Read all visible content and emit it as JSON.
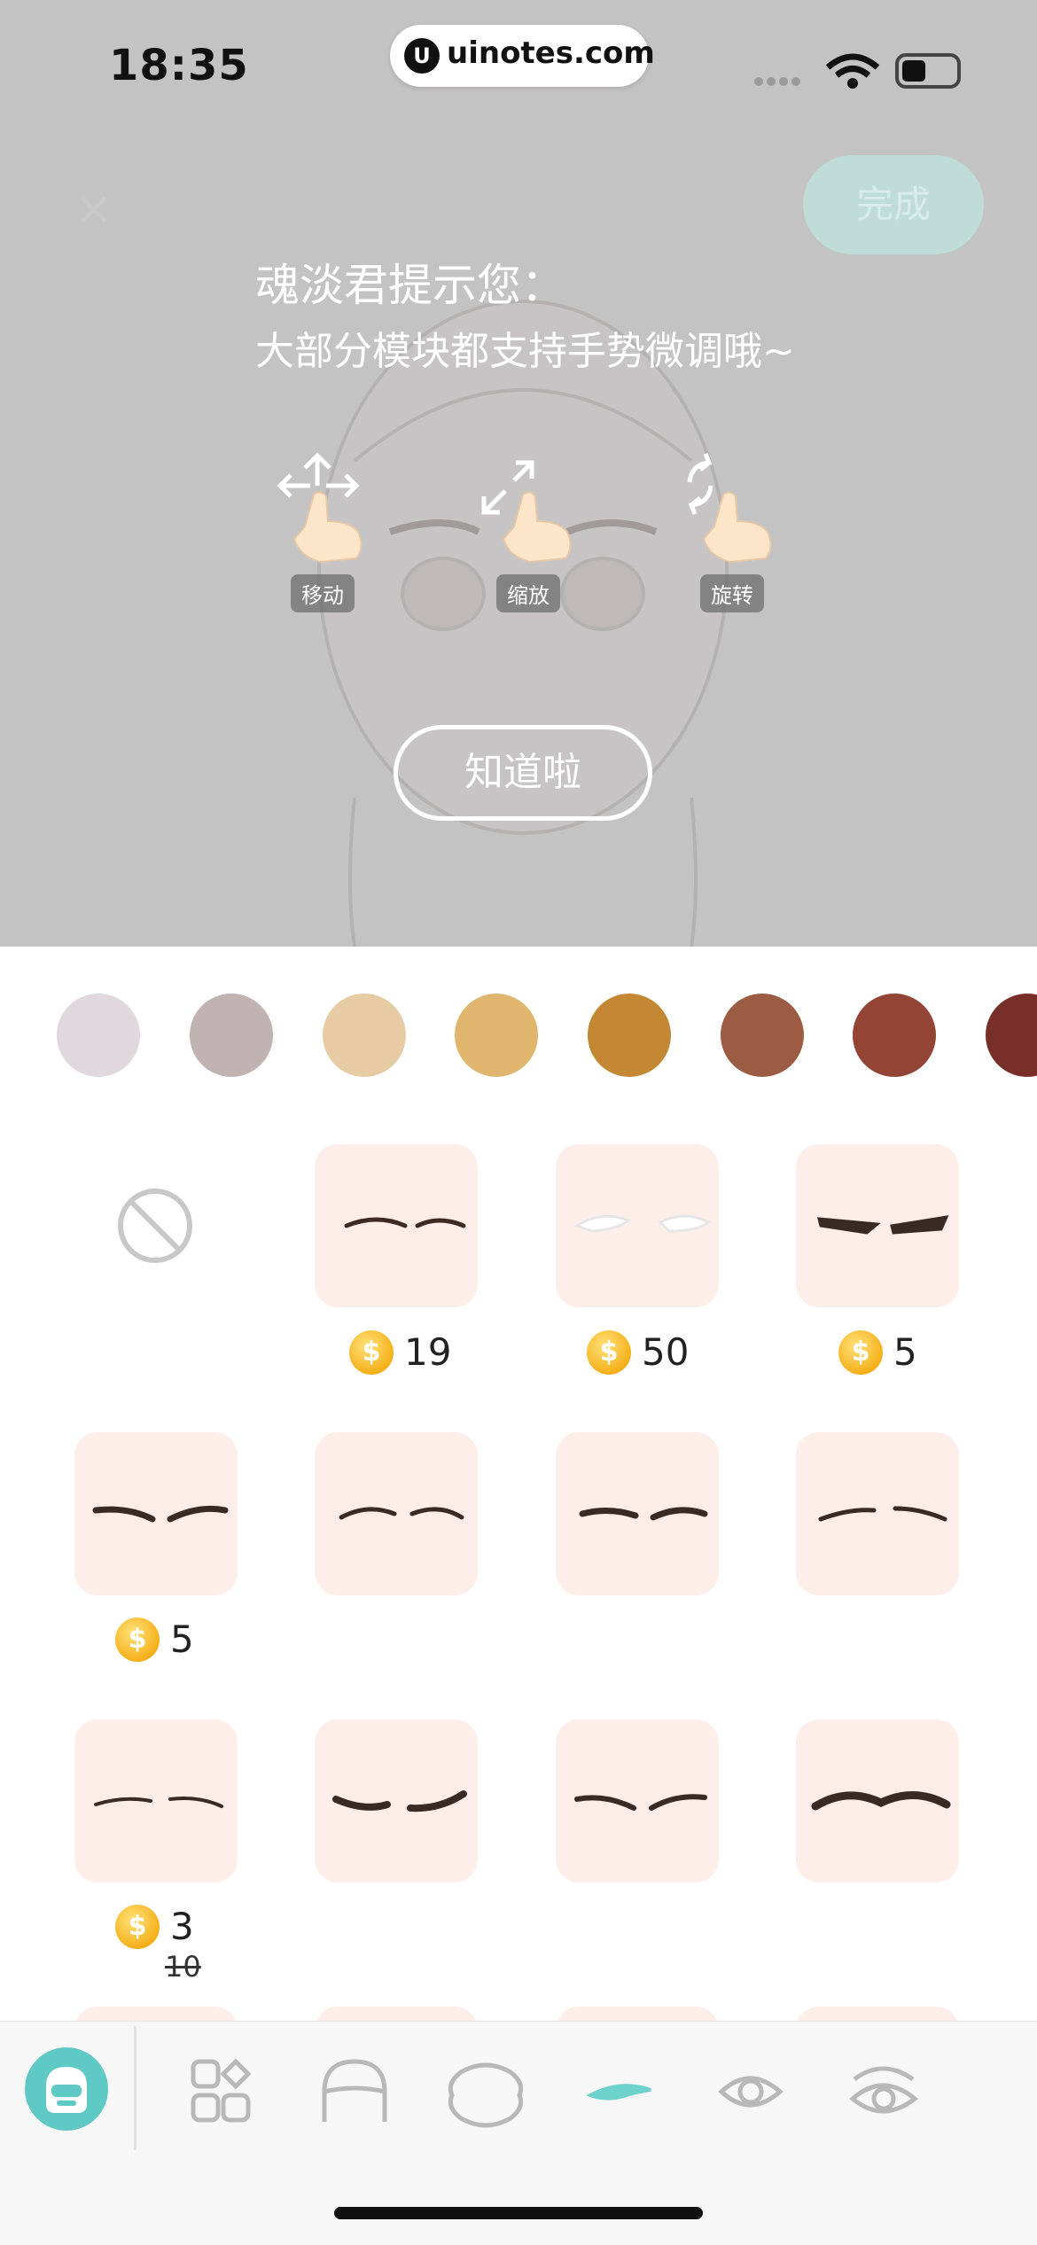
{
  "status_bar": {
    "time": "18:35",
    "url": "uinotes.com",
    "url_logo": "U"
  },
  "header": {
    "close_icon": "×",
    "done_label": "完成"
  },
  "tip": {
    "title": "魂淡君提示您：",
    "body": "大部分模块都支持手势微调哦~",
    "gestures": [
      {
        "label": "移动",
        "icon": "move-hand-icon"
      },
      {
        "label": "缩放",
        "icon": "scale-hand-icon"
      },
      {
        "label": "旋转",
        "icon": "rotate-hand-icon"
      }
    ],
    "button_label": "知道啦"
  },
  "colors": [
    "#e1d8de",
    "#c0b3b1",
    "#e6cba5",
    "#e0b56e",
    "#c48834",
    "#9b5c43",
    "#944434",
    "#782f2a"
  ],
  "items": [
    {
      "label": "none",
      "price": ""
    },
    {
      "price": "19"
    },
    {
      "price": "50"
    },
    {
      "price": "5"
    },
    {
      "price": "5"
    },
    {
      "price": ""
    },
    {
      "price": ""
    },
    {
      "price": ""
    },
    {
      "price": "3",
      "original_price": "10"
    },
    {
      "price": ""
    },
    {
      "price": ""
    },
    {
      "price": ""
    }
  ],
  "coin_symbol": "$",
  "nav": {
    "active": "eyebrows",
    "tabs": [
      "avatar-icon",
      "apps-grid-icon",
      "hair-icon",
      "face-shape-icon",
      "eyebrows-icon",
      "eye-icon",
      "eye-lash-icon",
      "mouth-icon"
    ]
  }
}
